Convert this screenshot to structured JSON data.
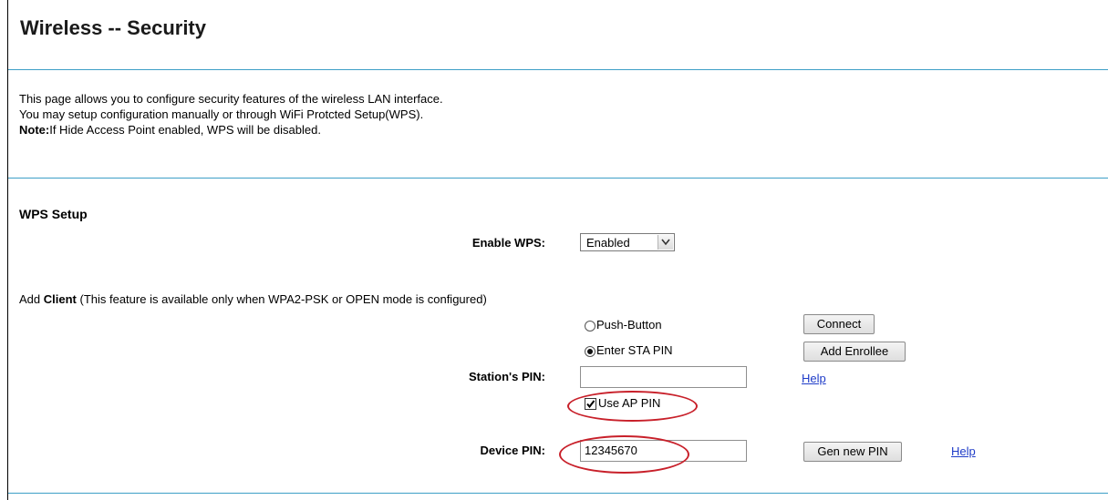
{
  "page": {
    "title": "Wireless -- Security",
    "description": [
      "This page allows you to configure security features of the wireless LAN interface.",
      "You may setup configuration manually or through WiFi Protcted Setup(WPS)."
    ],
    "note_label": "Note:",
    "note_text": "If Hide Access Point enabled, WPS will be disabled."
  },
  "wps": {
    "section_title": "WPS Setup",
    "enable_label": "Enable WPS:",
    "enable_value": "Enabled",
    "add_client_prefix": "Add ",
    "add_client_bold": "Client",
    "add_client_suffix": " (This feature is available only when WPA2-PSK or OPEN mode is configured)",
    "push_button_label": "Push-Button",
    "enter_pin_label": "Enter STA PIN",
    "selected_mode": "Enter STA PIN",
    "connect_button": "Connect",
    "add_enrollee_button": "Add Enrollee",
    "station_pin_label": "Station's PIN:",
    "station_pin_value": "",
    "help_link_1": "Help",
    "use_ap_pin_label": "Use AP PIN",
    "use_ap_pin_checked": true,
    "device_pin_label": "Device PIN:",
    "device_pin_value": "12345670",
    "gen_pin_button": "Gen new PIN",
    "help_link_2": "Help"
  },
  "colors": {
    "rule": "#3d9fc7",
    "highlight": "#c8202a",
    "link": "#1f3cc8"
  }
}
